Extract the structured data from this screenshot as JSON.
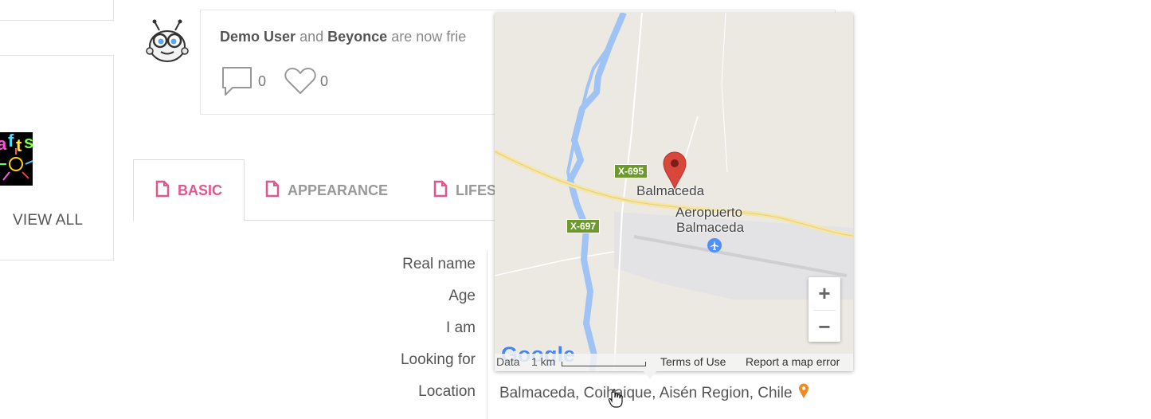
{
  "sidebar": {
    "view_all": "VIEW ALL"
  },
  "activity": {
    "user1": "Demo User",
    "connector": "and",
    "user2": "Beyonce",
    "suffix": "are now frie",
    "comments_count": "0",
    "likes_count": "0"
  },
  "tabs": [
    {
      "label": "BASIC",
      "active": true
    },
    {
      "label": "APPEARANCE",
      "active": false
    },
    {
      "label": "LIFES",
      "active": false
    }
  ],
  "profile_rows": {
    "real_name": "Real name",
    "age": "Age",
    "i_am": "I am",
    "looking_for": "Looking for",
    "location": "Location",
    "location_value": "Balmaceda, Coihaique, Aisén Region, Chile"
  },
  "map": {
    "town": "Balmaceda",
    "airport_line1": "Aeropuerto",
    "airport_line2": "Balmaceda",
    "road1": "X-695",
    "road2": "X-697",
    "zoom_in": "+",
    "zoom_out": "−",
    "google_logo": "Google",
    "footer_data": "Data",
    "footer_scale": "1 km",
    "terms": "Terms of Use",
    "report": "Report a map error"
  },
  "colors": {
    "accent_pink": "#e0578f",
    "marker_red": "#d9463b",
    "location_pin_orange": "#f08a24",
    "river_blue": "#9fc3f5"
  }
}
